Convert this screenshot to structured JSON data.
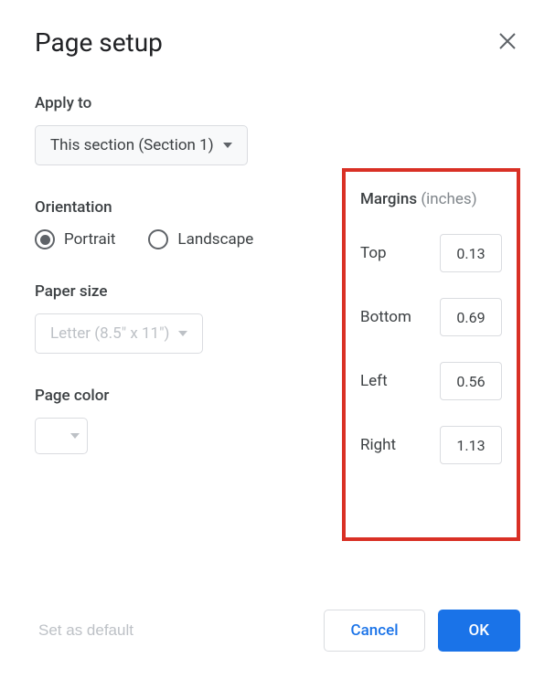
{
  "dialog": {
    "title": "Page setup"
  },
  "applyTo": {
    "label": "Apply to",
    "value": "This section (Section 1)"
  },
  "orientation": {
    "label": "Orientation",
    "portrait": "Portrait",
    "landscape": "Landscape",
    "selected": "portrait"
  },
  "paperSize": {
    "label": "Paper size",
    "value": "Letter (8.5\" x 11\")"
  },
  "pageColor": {
    "label": "Page color"
  },
  "margins": {
    "label": "Margins",
    "unit": "(inches)",
    "top": {
      "label": "Top",
      "value": "0.13"
    },
    "bottom": {
      "label": "Bottom",
      "value": "0.69"
    },
    "left": {
      "label": "Left",
      "value": "0.56"
    },
    "right": {
      "label": "Right",
      "value": "1.13"
    }
  },
  "buttons": {
    "setDefault": "Set as default",
    "cancel": "Cancel",
    "ok": "OK"
  }
}
